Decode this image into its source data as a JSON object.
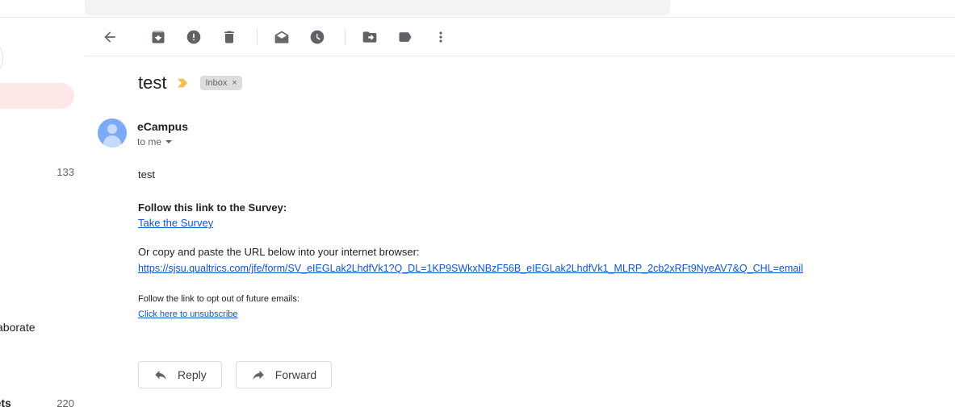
{
  "sidebar": {
    "active_item_color": "#fce8e6",
    "inbox_count": "133",
    "collaborate_label": "ollaborate",
    "tickets_label": "ckets",
    "tickets_count": "220"
  },
  "toolbar": {
    "back_icon": "back-arrow-icon",
    "archive_icon": "archive-icon",
    "spam_icon": "report-spam-icon",
    "delete_icon": "delete-icon",
    "mark_unread_icon": "mark-unread-icon",
    "snooze_icon": "snooze-clock-icon",
    "move_to_icon": "move-to-folder-icon",
    "labels_icon": "label-tag-icon",
    "more_icon": "more-options-icon"
  },
  "subject": {
    "text": "test",
    "label_icon_color": "#f2c14b",
    "chip_label": "Inbox",
    "chip_remove": "×"
  },
  "sender": {
    "name": "eCampus",
    "recipient": "to me"
  },
  "body": {
    "greeting": "test",
    "survey_heading": "Follow this link to the Survey:",
    "take_survey_link": "Take the Survey",
    "copy_paste_text": "Or copy and paste the URL below into your internet browser:",
    "survey_url": "https://sjsu.qualtrics.com/jfe/form/SV_eIEGLak2LhdfVk1?Q_DL=1KP9SWkxNBzF56B_eIEGLak2LhdfVk1_MLRP_2cb2xRFt9NyeAV7&Q_CHL=email",
    "optout_text": "Follow the link to opt out of future emails:",
    "unsubscribe_link": "Click here to unsubscribe",
    "link_color": "#1155cc"
  },
  "actions": {
    "reply_label": "Reply",
    "forward_label": "Forward"
  }
}
